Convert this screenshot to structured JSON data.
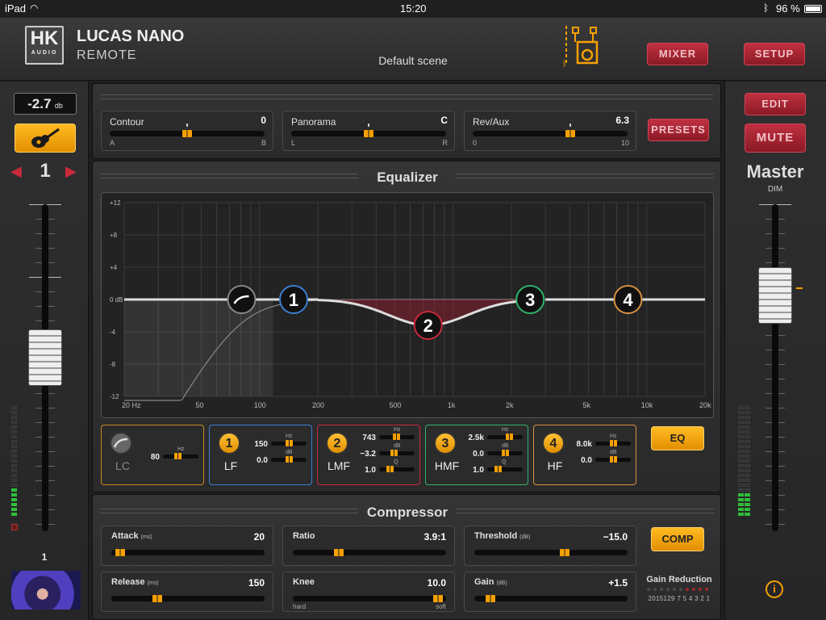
{
  "status": {
    "device": "iPad",
    "time": "15:20",
    "battery": "96 %"
  },
  "header": {
    "brand_top": "LUCAS NANO",
    "brand_bottom": "REMOTE",
    "logo": "HK",
    "logo_sub": "AUDIO",
    "scene": "Default scene",
    "mixer_label": "MIXER",
    "setup_label": "SETUP"
  },
  "channel": {
    "gain": "-2.7",
    "gain_unit": "db",
    "number": "1",
    "bottom_number": "1",
    "instrument_icon": "guitar-icon",
    "fader_level": 0.53
  },
  "master": {
    "edit_label": "EDIT",
    "mute_label": "MUTE",
    "title": "Master",
    "sub": "DIM",
    "fader_level": 0.72
  },
  "top_controls": [
    {
      "name": "Contour",
      "value": "0",
      "min": "A",
      "max": "B",
      "pos": 0.5
    },
    {
      "name": "Panorama",
      "value": "C",
      "min": "L",
      "max": "R",
      "pos": 0.5
    },
    {
      "name": "Rev/Aux",
      "value": "6.3",
      "min": "0",
      "max": "10",
      "pos": 0.63
    }
  ],
  "presets_label": "PRESETS",
  "equalizer": {
    "title": "Equalizer",
    "y_ticks": [
      "+12",
      "+8",
      "+4",
      "0 dB",
      "-4",
      "-8",
      "-12"
    ],
    "x_ticks": [
      "20 Hz",
      "50",
      "100",
      "200",
      "500",
      "1k",
      "2k",
      "5k",
      "10k",
      "20k"
    ],
    "nodes": [
      {
        "label": "1",
        "color": "#3b7fd0",
        "freq": 150,
        "gain": 0
      },
      {
        "label": "2",
        "color": "#c82a3a",
        "freq": 743,
        "gain": -3.2
      },
      {
        "label": "3",
        "color": "#2fb36a",
        "freq": 2500,
        "gain": 0
      },
      {
        "label": "4",
        "color": "#d89040",
        "freq": 8000,
        "gain": 0
      }
    ],
    "lc_freq": 80,
    "eq_label": "EQ",
    "bands": [
      {
        "id": "lc",
        "name": "LC",
        "border": "#c98a1e",
        "rows": [
          {
            "v": "80",
            "u": "Hz",
            "p": 0.4
          }
        ]
      },
      {
        "id": "lf",
        "num": "1",
        "name": "LF",
        "border": "#3b7fd0",
        "rows": [
          {
            "v": "150",
            "u": "Hz",
            "p": 0.5
          },
          {
            "v": "0.0",
            "u": "dB",
            "p": 0.5
          }
        ]
      },
      {
        "id": "lmf",
        "num": "2",
        "name": "LMF",
        "border": "#c82a3a",
        "rows": [
          {
            "v": "743",
            "u": "Hz",
            "p": 0.48
          },
          {
            "v": "−3.2",
            "u": "dB",
            "p": 0.4
          },
          {
            "v": "1.0",
            "u": "Q",
            "p": 0.3
          }
        ]
      },
      {
        "id": "hmf",
        "num": "3",
        "name": "HMF",
        "border": "#2fb36a",
        "rows": [
          {
            "v": "2.5k",
            "u": "Hz",
            "p": 0.62
          },
          {
            "v": "0.0",
            "u": "dB",
            "p": 0.5
          },
          {
            "v": "1.0",
            "u": "Q",
            "p": 0.3
          }
        ]
      },
      {
        "id": "hf",
        "num": "4",
        "name": "HF",
        "border": "#d89040",
        "rows": [
          {
            "v": "8.0k",
            "u": "Hz",
            "p": 0.5
          },
          {
            "v": "0.0",
            "u": "dB",
            "p": 0.5
          }
        ]
      }
    ]
  },
  "compressor": {
    "title": "Compressor",
    "comp_label": "COMP",
    "controls": [
      {
        "name": "Attack",
        "unit": "(ms)",
        "value": "20",
        "pos": 0.05
      },
      {
        "name": "Ratio",
        "unit": "",
        "value": "3.9:1",
        "pos": 0.3
      },
      {
        "name": "Threshold",
        "unit": "(dB)",
        "value": "−15.0",
        "pos": 0.6
      },
      {
        "name": "Release",
        "unit": "(ms)",
        "value": "150",
        "pos": 0.3
      },
      {
        "name": "Knee",
        "unit": "",
        "value": "10.0",
        "pos": 0.97,
        "min": "hard",
        "max": "soft"
      },
      {
        "name": "Gain",
        "unit": "(dB)",
        "value": "+1.5",
        "pos": 0.1
      }
    ],
    "gain_reduction_label": "Gain Reduction",
    "gr_scale": "2015129 7 5 4 3 2 1"
  }
}
